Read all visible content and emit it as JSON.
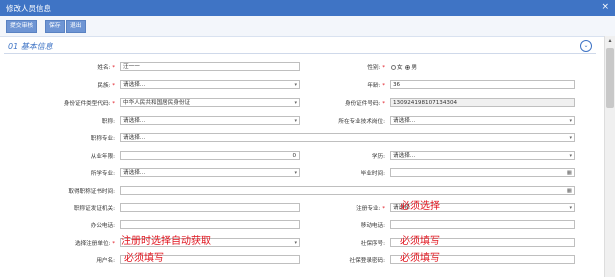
{
  "window": {
    "title": "修改人员信息",
    "close": "×"
  },
  "toolbar": {
    "submit": "提交审核",
    "save": "保存",
    "exit": "退出"
  },
  "section": {
    "number": "01",
    "title": "基本信息"
  },
  "fields": {
    "name": {
      "label": "姓名:",
      "value": "汪一一"
    },
    "gender": {
      "label": "性别:",
      "options": [
        "女",
        "男"
      ],
      "selected": "男"
    },
    "ethnicity": {
      "label": "民族:",
      "value": "请选择..."
    },
    "age": {
      "label": "年龄:",
      "value": "36"
    },
    "id_type": {
      "label": "身份证件类型代码:",
      "value": "中华人民共和国居民身份证"
    },
    "id_number": {
      "label": "身份证件号码:",
      "value": "130924198107134304"
    },
    "title": {
      "label": "职称:",
      "value": "请选择..."
    },
    "tech_post": {
      "label": "所在专业技术岗位:",
      "value": "请选择..."
    },
    "title_major": {
      "label": "职称专业:",
      "value": "请选择..."
    },
    "work_years": {
      "label": "从业年限:",
      "value": "0"
    },
    "education": {
      "label": "学历:",
      "value": "请选择..."
    },
    "study_major": {
      "label": "所学专业:",
      "value": "请选择..."
    },
    "grad_time": {
      "label": "毕业时间:",
      "value": ""
    },
    "title_cert_time": {
      "label": "取得职称证书时间:",
      "value": ""
    },
    "title_cert_org": {
      "label": "职称证发证机关:",
      "value": ""
    },
    "reg_major": {
      "label": "注册专业:",
      "value": "请选择"
    },
    "office_phone": {
      "label": "办公电话:",
      "value": ""
    },
    "mobile": {
      "label": "移动电话:",
      "value": ""
    },
    "reg_unit": {
      "label": "选择注册单位:",
      "value": ""
    },
    "social_no": {
      "label": "社保序号:",
      "value": ""
    },
    "username": {
      "label": "用户名:",
      "value": ""
    },
    "social_pwd": {
      "label": "社保登录密码:",
      "value": ""
    }
  },
  "annotations": {
    "reg_major": "必须选择",
    "reg_unit": "注册时选择自动获取",
    "social_no": "必须填写",
    "username": "必须填写",
    "social_pwd": "必须填写"
  },
  "icons": {
    "dropdown": "▾",
    "calendar": "▦",
    "collapse": "⌄",
    "scroll_up": "▴"
  },
  "colors": {
    "titlebar": "#3f74c5",
    "required": "#e0141e",
    "annotation": "#e0141e"
  }
}
